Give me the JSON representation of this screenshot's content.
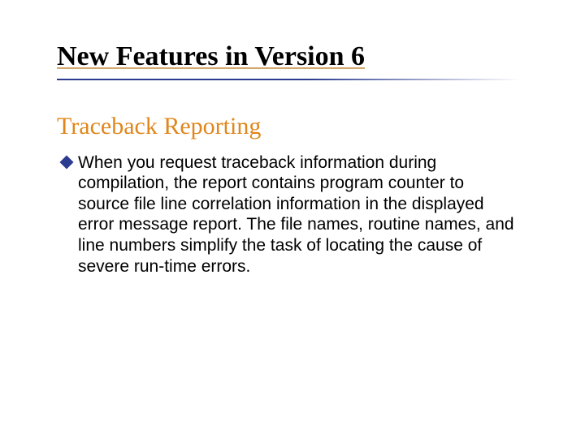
{
  "title": "New Features in Version 6",
  "subtitle": "Traceback Reporting",
  "bullets": [
    "When you request traceback information during compilation, the report contains program counter to source file line correlation information in the displayed error message report. The file names, routine names, and line numbers simplify the task of locating the cause of severe run-time errors."
  ]
}
